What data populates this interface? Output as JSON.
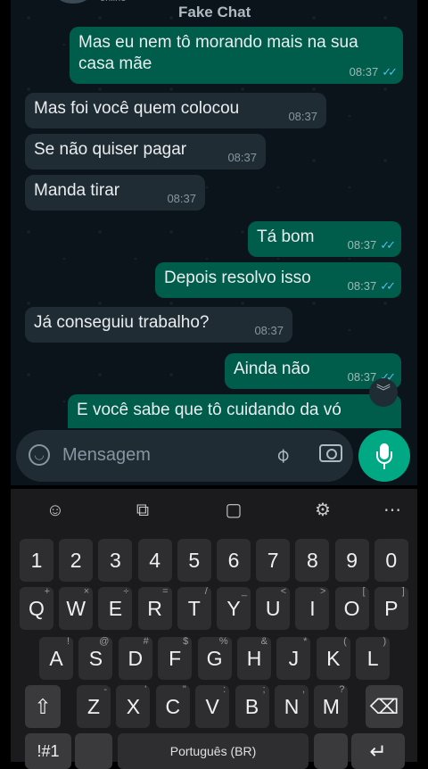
{
  "header": {
    "title": "Fake Chat",
    "status": "online"
  },
  "messages": [
    {
      "dir": "out",
      "text": "Mas eu nem tô morando mais na sua casa mãe",
      "time": "08:37",
      "read": true
    },
    {
      "dir": "in",
      "text": "Mas foi você quem colocou",
      "time": "08:37"
    },
    {
      "dir": "in",
      "text": "Se não quiser pagar",
      "time": "08:37"
    },
    {
      "dir": "in",
      "text": "Manda tirar",
      "time": "08:37"
    },
    {
      "dir": "out",
      "text": "Tá bom",
      "time": "08:37",
      "read": true
    },
    {
      "dir": "out",
      "text": "Depois resolvo isso",
      "time": "08:37",
      "read": true
    },
    {
      "dir": "in",
      "text": "Já conseguiu trabalho?",
      "time": "08:37"
    },
    {
      "dir": "out",
      "text": "Ainda não",
      "time": "08:37",
      "read": true
    },
    {
      "dir": "out",
      "text": "E você sabe que tô cuidando da vó",
      "time": "",
      "read": false
    }
  ],
  "input": {
    "placeholder": "Mensagem"
  },
  "icons": {
    "emoji": "emoji-icon",
    "attach": "paperclip-icon",
    "camera": "camera-icon",
    "mic": "microphone-icon",
    "scroll_down": "chevron-double-down-icon",
    "read_ticks": "double-check-icon"
  },
  "keyboard": {
    "toolbar": [
      "emoji-icon",
      "translate-icon",
      "clipboard-icon",
      "settings-icon",
      "more-icon"
    ],
    "numbers": [
      "1",
      "2",
      "3",
      "4",
      "5",
      "6",
      "7",
      "8",
      "9",
      "0"
    ],
    "row1": [
      {
        "k": "Q",
        "s": "+"
      },
      {
        "k": "W",
        "s": "×"
      },
      {
        "k": "E",
        "s": "÷"
      },
      {
        "k": "R",
        "s": "="
      },
      {
        "k": "T",
        "s": "/"
      },
      {
        "k": "Y",
        "s": "_"
      },
      {
        "k": "U",
        "s": "<"
      },
      {
        "k": "I",
        "s": ">"
      },
      {
        "k": "O",
        "s": "["
      },
      {
        "k": "P",
        "s": "]"
      }
    ],
    "row2": [
      {
        "k": "A",
        "s": "!"
      },
      {
        "k": "S",
        "s": "@"
      },
      {
        "k": "D",
        "s": "#"
      },
      {
        "k": "F",
        "s": "$"
      },
      {
        "k": "G",
        "s": "%"
      },
      {
        "k": "H",
        "s": "&"
      },
      {
        "k": "J",
        "s": "*"
      },
      {
        "k": "K",
        "s": "("
      },
      {
        "k": "L",
        "s": ")"
      }
    ],
    "row3": [
      {
        "k": "Z",
        "s": "-"
      },
      {
        "k": "X",
        "s": "'"
      },
      {
        "k": "C",
        "s": "\""
      },
      {
        "k": "V",
        "s": ":"
      },
      {
        "k": "B",
        "s": ";"
      },
      {
        "k": "N",
        "s": ","
      },
      {
        "k": "M",
        "s": "?"
      }
    ],
    "symbols_label": "!#1",
    "space_label": "Português (BR)",
    "shift": "shift-icon",
    "backspace": "backspace-icon",
    "enter": "enter-icon"
  },
  "colors": {
    "outgoing": "#005c4b",
    "incoming": "#202c33",
    "accent": "#00a884",
    "read_tick": "#53bdeb"
  }
}
